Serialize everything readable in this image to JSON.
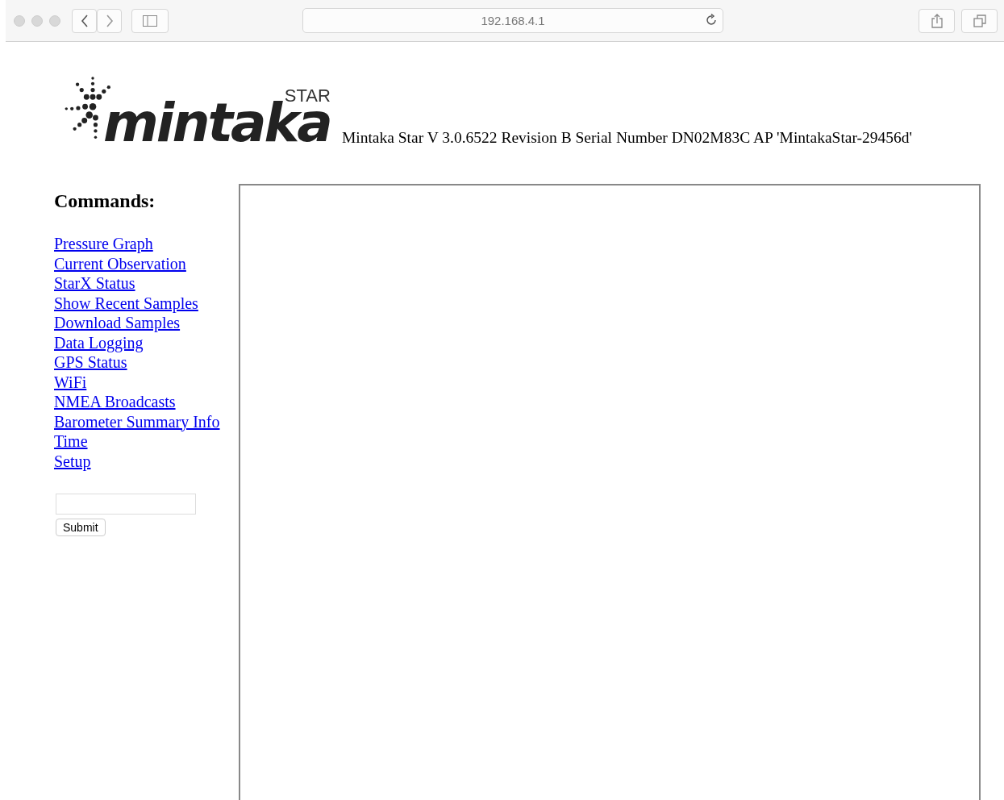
{
  "browser": {
    "url": "192.168.4.1"
  },
  "logo": {
    "wordmark": "mintaka",
    "tagline": "STAR"
  },
  "device_info": "Mintaka Star V 3.0.6522 Revision B Serial Number DN02M83C AP 'MintakaStar-29456d'",
  "sidebar": {
    "heading": "Commands:",
    "links": [
      "Pressure Graph",
      "Current Observation",
      "StarX Status",
      "Show Recent Samples",
      "Download Samples",
      "Data Logging",
      "GPS Status",
      "WiFi",
      "NMEA Broadcasts",
      "Barometer Summary Info",
      "Time",
      "Setup"
    ],
    "submit_button": "Submit"
  }
}
